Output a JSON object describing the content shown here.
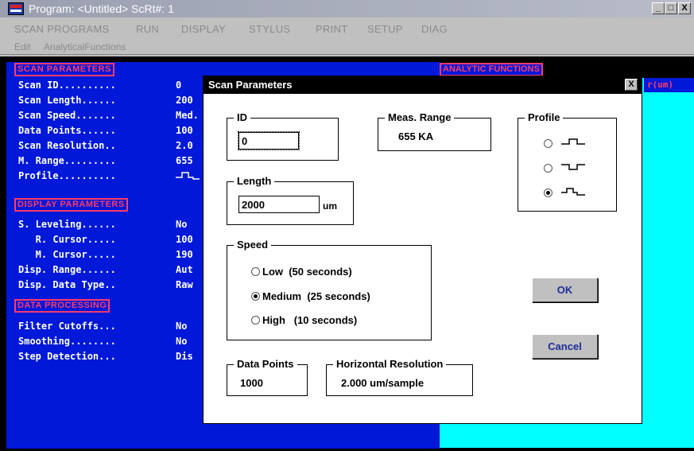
{
  "window": {
    "title": "Program: <Untitled>  ScRt#: 1",
    "controls": [
      "_",
      "□",
      "X"
    ]
  },
  "menubar": {
    "items": [
      "SCAN PROGRAMS",
      "RUN",
      "DISPLAY",
      "STYLUS",
      "PRINT",
      "SETUP",
      "DIAG"
    ]
  },
  "menubar2": {
    "items": [
      "Edit",
      "AnalyticalFunctions"
    ]
  },
  "background": {
    "scan_parameters_header": "SCAN PARAMETERS",
    "scan_params": [
      {
        "label": "Scan ID..........",
        "value": "0"
      },
      {
        "label": "Scan Length......",
        "value": "200"
      },
      {
        "label": "Scan Speed.......",
        "value": "Med."
      },
      {
        "label": "Data Points......",
        "value": "100"
      },
      {
        "label": "Scan Resolution..",
        "value": "2.0"
      },
      {
        "label": "M. Range.........",
        "value": "655"
      },
      {
        "label": "Profile..........",
        "value": ""
      }
    ],
    "display_parameters_header": "DISPLAY PARAMETERS",
    "display_params": [
      {
        "label": "S. Leveling......",
        "value": "No"
      },
      {
        "label": "   R. Cursor.....",
        "value": "100"
      },
      {
        "label": "   M. Cursor.....",
        "value": "190"
      },
      {
        "label": "Disp. Range......",
        "value": "Aut"
      },
      {
        "label": "Disp. Data Type..",
        "value": "Raw"
      }
    ],
    "data_processing_header": "DATA PROCESSING",
    "processing_params": [
      {
        "label": "Filter Cutoffs...",
        "value": "No"
      },
      {
        "label": "Smoothing........",
        "value": "No"
      },
      {
        "label": "Step Detection...",
        "value": "Dis"
      }
    ],
    "analytic_functions_header": "ANALYTIC FUNCTIONS",
    "right_label": "r(um)"
  },
  "dialog": {
    "title": "Scan Parameters",
    "close_label": "X",
    "id": {
      "label": "ID",
      "value": "0"
    },
    "meas_range": {
      "label": "Meas. Range",
      "value": "655 KA"
    },
    "profile": {
      "label": "Profile",
      "selected_index": 2
    },
    "length": {
      "label": "Length",
      "value": "2000",
      "unit": "um"
    },
    "speed": {
      "label": "Speed",
      "options": [
        {
          "label": "Low  (50 seconds)",
          "selected": false
        },
        {
          "label": "Medium  (25 seconds)",
          "selected": true
        },
        {
          "label": "High   (10 seconds)",
          "selected": false
        }
      ]
    },
    "data_points": {
      "label": "Data Points",
      "value": "1000"
    },
    "horizontal_resolution": {
      "label": "Horizontal Resolution",
      "value": "2.000 um/sample"
    },
    "ok_label": "OK",
    "cancel_label": "Cancel"
  },
  "colors": {
    "blue_pane": "#0018d8",
    "cyan_pane": "#00ffff",
    "header_red": "#ff3b6a",
    "button_text": "#1f2d9a"
  }
}
